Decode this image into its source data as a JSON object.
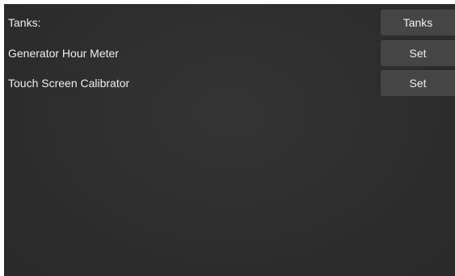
{
  "settings": {
    "rows": [
      {
        "label": "Tanks:",
        "button_label": "Tanks"
      },
      {
        "label": "Generator Hour Meter",
        "button_label": "Set"
      },
      {
        "label": "Touch Screen Calibrator",
        "button_label": "Set"
      }
    ]
  },
  "colors": {
    "background": "#2e2e2e",
    "button": "#454545",
    "text": "#eeeeee"
  }
}
